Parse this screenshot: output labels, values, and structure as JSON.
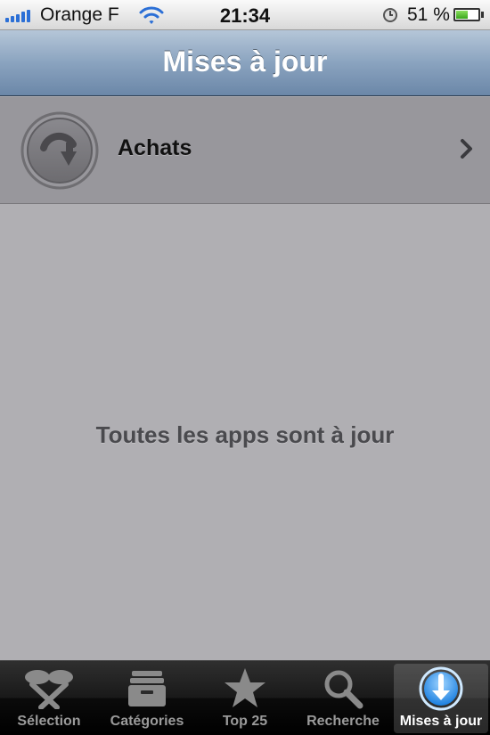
{
  "status_bar": {
    "carrier": "Orange F",
    "time": "21:34",
    "battery_percent": "51 %",
    "battery_level": 0.51,
    "icons": [
      "signal-icon",
      "wifi-icon",
      "alarm-icon",
      "battery-icon"
    ]
  },
  "nav": {
    "title": "Mises à jour"
  },
  "purchases_row": {
    "label": "Achats",
    "icon": "purchased-download-icon"
  },
  "empty_message": "Toutes les apps sont à jour",
  "tab_bar": {
    "active_index": 4,
    "tabs": [
      {
        "label": "Sélection",
        "icon": "featured-icon"
      },
      {
        "label": "Catégories",
        "icon": "categories-icon"
      },
      {
        "label": "Top 25",
        "icon": "star-icon"
      },
      {
        "label": "Recherche",
        "icon": "search-icon"
      },
      {
        "label": "Mises à jour",
        "icon": "updates-icon"
      }
    ]
  },
  "colors": {
    "accent_blue": "#2b6fd6",
    "nav_bar": "#8aa3bf",
    "background": "#b0afb3",
    "row_background": "#98979c"
  }
}
